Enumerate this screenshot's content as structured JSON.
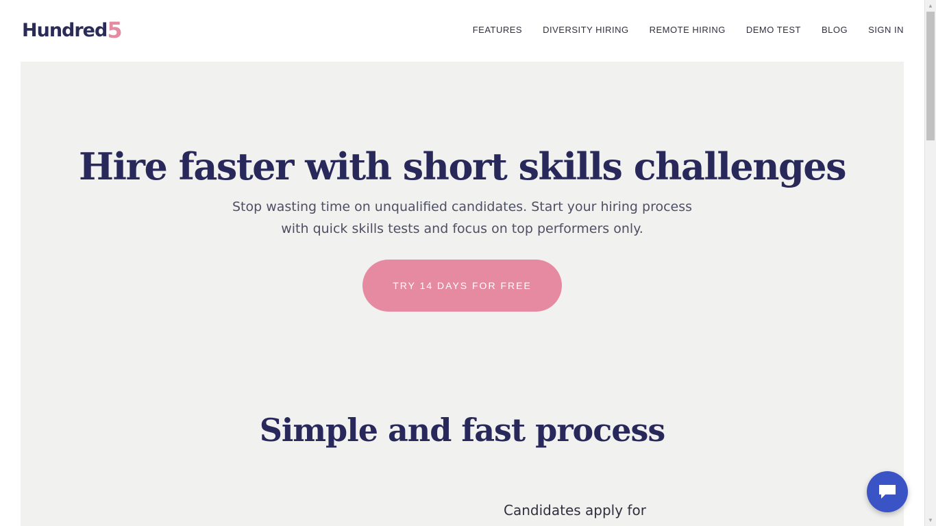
{
  "header": {
    "logo_text": "Hundred",
    "logo_digit": "5",
    "nav": [
      {
        "label": "FEATURES"
      },
      {
        "label": "DIVERSITY HIRING"
      },
      {
        "label": "REMOTE HIRING"
      },
      {
        "label": "DEMO TEST"
      },
      {
        "label": "BLOG"
      },
      {
        "label": "SIGN IN"
      }
    ]
  },
  "hero": {
    "title": "Hire faster with short skills challenges",
    "subtitle_line1": "Stop wasting time on unqualified candidates. Start your hiring process",
    "subtitle_line2": "with quick skills tests and focus on top performers only.",
    "cta_label": "TRY 14 DAYS FOR FREE"
  },
  "process": {
    "title": "Simple and fast process",
    "step_text": "Candidates apply for"
  },
  "chat": {
    "icon": "chat-bubble-icon"
  },
  "colors": {
    "brand_navy": "#28285a",
    "brand_pink": "#e58aa1",
    "hero_bg": "#f1f1ef",
    "chat_blue": "#3a54c5"
  }
}
